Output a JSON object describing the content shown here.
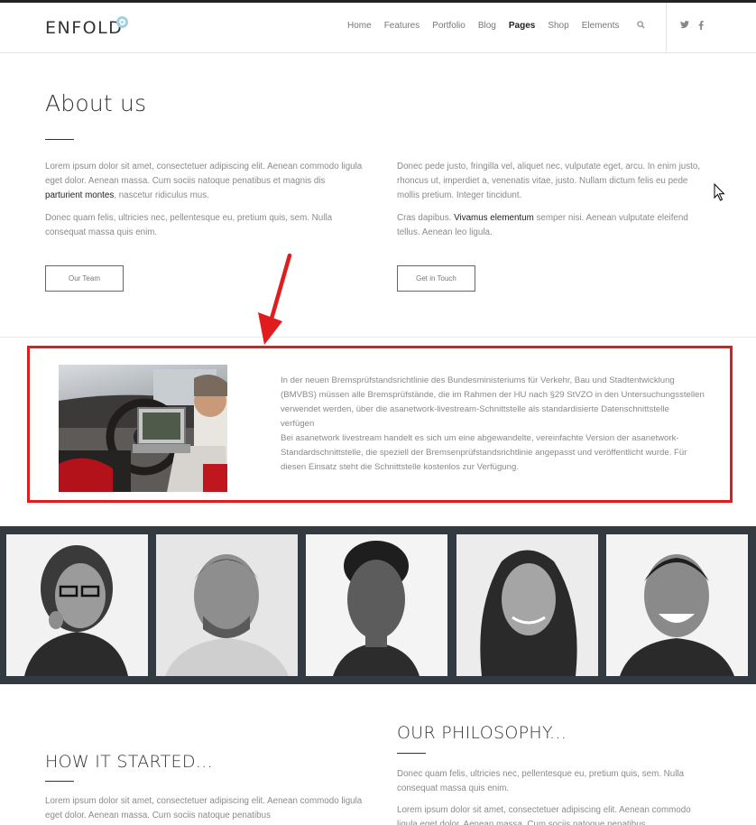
{
  "header": {
    "logo": "ENFOLD",
    "nav": [
      "Home",
      "Features",
      "Portfolio",
      "Blog",
      "Pages",
      "Shop",
      "Elements"
    ],
    "active_nav": "Pages",
    "search_icon": "search-icon",
    "social": [
      "twitter-icon",
      "facebook-icon"
    ]
  },
  "about": {
    "title": "About us",
    "left_p1_a": "Lorem ipsum dolor sit amet, consectetuer adipiscing elit. Aenean commodo ligula eget dolor. Aenean massa. Cum sociis natoque penatibus et magnis dis ",
    "left_p1_bold": "parturient montes",
    "left_p1_b": ", nascetur ridiculus mus.",
    "left_p2": "Donec quam felis, ultricies nec, pellentesque eu, pretium quis, sem. Nulla consequat massa quis enim.",
    "right_p1": "Donec pede justo, fringilla vel, aliquet nec, vulputate eget, arcu. In enim justo, rhoncus ut, imperdiet a, venenatis vitae, justo. Nullam dictum felis eu pede mollis pretium. Integer tincidunt.",
    "right_p2_a": "Cras dapibus. ",
    "right_p2_bold": "Vivamus elementum",
    "right_p2_b": " semper nisi. Aenean vulputate eleifend tellus. Aenean leo ligula.",
    "btn_team": "Our Team",
    "btn_touch": "Get in Touch"
  },
  "callout": {
    "line1": "In der neuen Bremsprüfstandsrichtlinie des Bundesministeriums für Verkehr, Bau und Stadtentwicklung (BMVBS) müssen alle Bremsprüfstände, die im Rahmen der HU nach §29 StVZO in den Untersuchungsstellen verwendet werden, über die asanetwork-livestream-Schnittstelle als standardisierte Datenschnittstelle verfügen",
    "line2": "Bei asanetwork livestream handelt es sich um eine abgewandelte, vereinfachte Version der asanetwork-Standardschnittstelle, die speziell der Bremsenprüfstandsrichtlinie angepasst und veröffentlicht wurde. Für diesen Einsatz steht die Schnittstelle kostenlos zur Verfügung."
  },
  "sections": {
    "how_title": "HOW IT STARTED...",
    "how_p": "Lorem ipsum dolor sit amet, consectetuer adipiscing elit. Aenean commodo ligula eget dolor. Aenean massa. Cum sociis natoque penatibus",
    "phil_title": "OUR PHILOSOPHY...",
    "phil_p1": "Donec quam felis, ultricies nec, pellentesque eu, pretium quis, sem. Nulla consequat massa quis enim.",
    "phil_p2": "Lorem ipsum dolor sit amet, consectetuer adipiscing elit. Aenean commodo ligula eget dolor. Aenean massa. Cum sociis natoque penatibus"
  },
  "colors": {
    "accent_red": "#e01c1c",
    "strip_bg": "#333a42",
    "logo_accent": "#9fd0e4"
  }
}
